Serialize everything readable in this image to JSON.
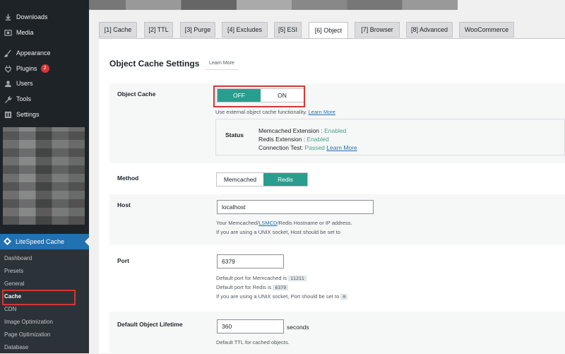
{
  "sidebar": {
    "items": [
      {
        "label": "Downloads",
        "icon": "download-icon"
      },
      {
        "label": "Media",
        "icon": "media-icon"
      },
      {
        "label": "Appearance",
        "icon": "paintbrush-icon"
      },
      {
        "label": "Plugins",
        "icon": "plugin-icon",
        "badge": "2"
      },
      {
        "label": "Users",
        "icon": "user-icon"
      },
      {
        "label": "Tools",
        "icon": "wrench-icon"
      },
      {
        "label": "Settings",
        "icon": "settings-icon"
      }
    ],
    "litespeed_label": "LiteSpeed Cache",
    "submenu": [
      "Dashboard",
      "Presets",
      "General",
      "Cache",
      "CDN",
      "Image Optimization",
      "Page Optimization",
      "Database"
    ]
  },
  "tabs": [
    "[1] Cache",
    "[2] TTL",
    "[3] Purge",
    "[4] Excludes",
    "[5] ESI",
    "[6] Object",
    "[7] Browser",
    "[8] Advanced",
    "WooCommerce"
  ],
  "active_tab": "[6] Object",
  "main": {
    "title": "Object Cache Settings",
    "learn_more": "Learn More",
    "object_cache": {
      "label": "Object Cache",
      "off": "OFF",
      "on": "ON",
      "selected": "OFF",
      "help": "Use external object cache functionality.",
      "help_link": "Learn More"
    },
    "status": {
      "label": "Status",
      "memcached_label": "Memcached Extension :",
      "memcached_value": "Enabled",
      "redis_label": "Redis Extension :",
      "redis_value": "Enabled",
      "conn_label": "Connection Test:",
      "conn_value": "Passed",
      "conn_link": "Learn More"
    },
    "method": {
      "label": "Method",
      "opt1": "Memcached",
      "opt2": "Redis",
      "selected": "Redis"
    },
    "host": {
      "label": "Host",
      "value": "localhost",
      "help1_pre": "Your Memcached/",
      "help1_link": "LSMCD",
      "help1_post": "/Redis Hostname or IP address.",
      "help2": "If you are using a UNIX socket, Host should be set to"
    },
    "port": {
      "label": "Port",
      "value": "6379",
      "help1": "Default port for Memcached is",
      "help1_code": "11211",
      "help2": "Default port for Redis is",
      "help2_code": "6379",
      "help3": "If you are using a UNIX socket, Port should be set to",
      "help3_code": "0"
    },
    "lifetime": {
      "label": "Default Object Lifetime",
      "value": "360",
      "unit": "seconds",
      "help": "Default TTL for cached objects."
    }
  },
  "colors": {
    "accent": "#2a9d8f",
    "sidebar_bg": "#1d2327",
    "highlight_box": "#d63638",
    "menu_active": "#2271b1"
  }
}
